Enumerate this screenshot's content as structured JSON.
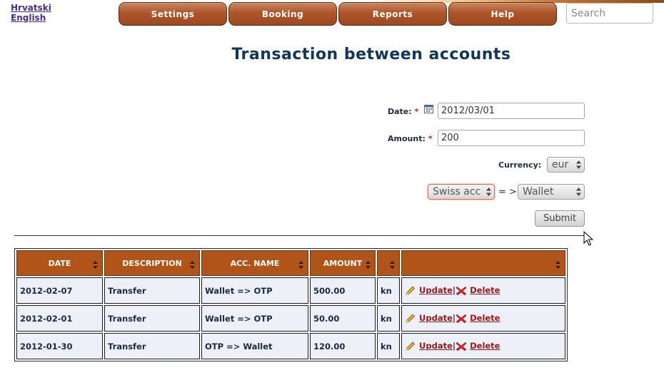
{
  "languages": [
    "Hrvatski",
    "English"
  ],
  "nav": {
    "items": [
      "Settings",
      "Booking",
      "Reports",
      "Help"
    ]
  },
  "search": {
    "placeholder": "Search",
    "value": ""
  },
  "page": {
    "title": "Transaction between accounts"
  },
  "form": {
    "date_label": "Date:",
    "date_value": "2012/03/01",
    "amount_label": "Amount:",
    "amount_value": "200",
    "required_mark": "*",
    "currency_label": "Currency:",
    "currency_value": "eur",
    "from_account": "Swiss acc",
    "arrow_text": "= >",
    "to_account": "Wallet",
    "submit_label": "Submit"
  },
  "table": {
    "headers": [
      "DATE",
      "DESCRIPTION",
      "ACC. NAME",
      "AMOUNT",
      "",
      ""
    ],
    "rows": [
      {
        "date": "2012-02-07",
        "description": "Transfer",
        "acc_name": "Wallet => OTP",
        "amount": "500.00",
        "currency": "kn"
      },
      {
        "date": "2012-02-01",
        "description": "Transfer",
        "acc_name": "Wallet => OTP",
        "amount": "50.00",
        "currency": "kn"
      },
      {
        "date": "2012-01-30",
        "description": "Transfer",
        "acc_name": "OTP => Wallet",
        "amount": "120.00",
        "currency": "kn"
      }
    ],
    "update_label": "Update",
    "separator": "|",
    "delete_label": "Delete"
  },
  "icons": {
    "calendar": "calendar-icon",
    "sort": "sort-arrows-icon",
    "edit": "pencil-icon",
    "delete": "red-x-icon",
    "cursor": "mouse-pointer-icon"
  },
  "colors": {
    "nav_button": "#b0552a",
    "table_header": "#b0541a",
    "title": "#10365e",
    "link": "#9a1818",
    "row_bg": "#eef0f8"
  }
}
